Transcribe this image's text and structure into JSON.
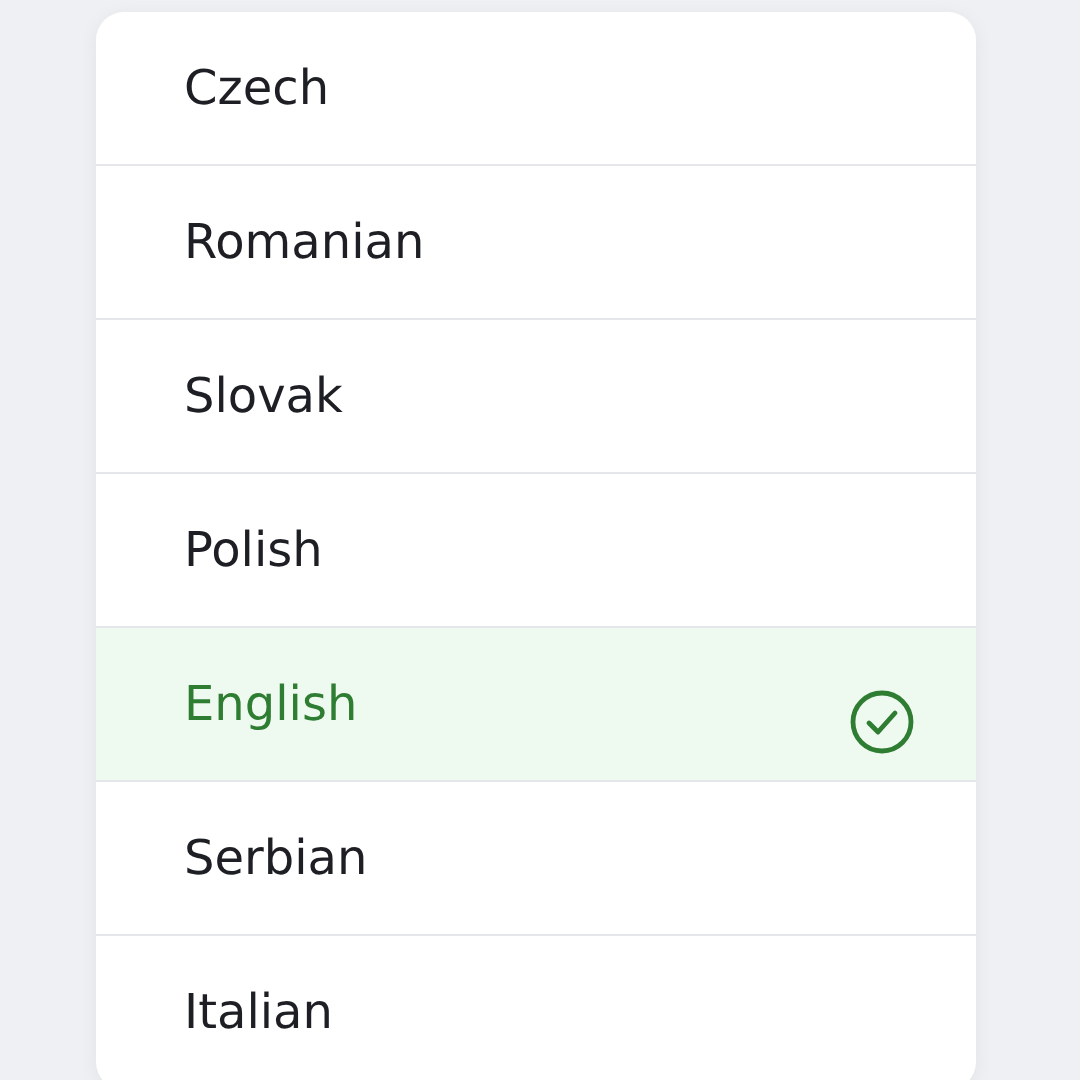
{
  "languages": [
    {
      "name": "Czech",
      "selected": false
    },
    {
      "name": "Romanian",
      "selected": false
    },
    {
      "name": "Slovak",
      "selected": false
    },
    {
      "name": "Polish",
      "selected": false
    },
    {
      "name": "English",
      "selected": true
    },
    {
      "name": "Serbian",
      "selected": false
    },
    {
      "name": "Italian",
      "selected": false
    }
  ]
}
